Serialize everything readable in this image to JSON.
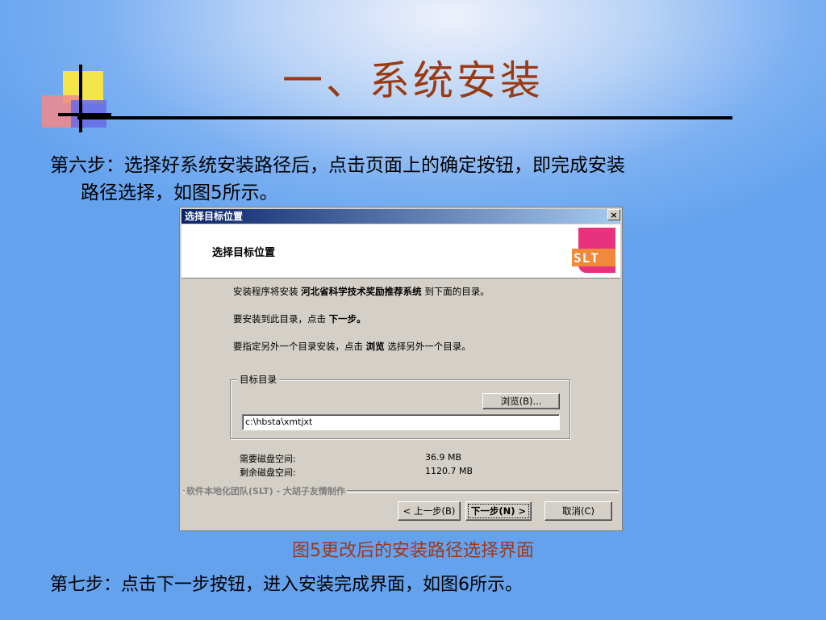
{
  "slide": {
    "title": "一、系统安装",
    "step6_line1": "第六步：选择好系统安装路径后，点击页面上的确定按钮，即完成安装",
    "step6_line2": "路径选择，如图5所示。",
    "caption": "图5更改后的安装路径选择界面",
    "step7": "第七步：点击下一步按钮，进入安装完成界面，如图6所示。"
  },
  "dialog": {
    "window_title": "选择目标位置",
    "close_glyph": "×",
    "header_title": "选择目标位置",
    "logo_text": "SLT",
    "line1_pre": "安装程序将安装",
    "line1_bold": "河北省科学技术奖励推荐系统",
    "line1_post": "到下面的目录。",
    "line2_pre": "要安装到此目录，点击",
    "line2_bold": "下一步。",
    "line3_pre": "要指定另外一个目录安装，点击",
    "line3_bold": "浏览",
    "line3_post": "选择另外一个目录。",
    "group_label": "目标目录",
    "browse_button": "浏览(B)...",
    "path_value": "c:\\hbsta\\xmtjxt",
    "required_label": "需要磁盘空间:",
    "required_value": "36.9 MB",
    "remaining_label": "剩余磁盘空间:",
    "remaining_value": "1120.7 MB",
    "credit": "软件本地化团队(SLT) - 大胡子友情制作",
    "back_button": "< 上一步(B)",
    "next_button": "下一步(N) >",
    "cancel_button": "取消(C)"
  },
  "colors": {
    "title": "#9a3a12",
    "caption": "#a03818",
    "titlebar": "#0a246a",
    "logo_pink": "#e8327e",
    "logo_orange": "#f08a3a"
  }
}
